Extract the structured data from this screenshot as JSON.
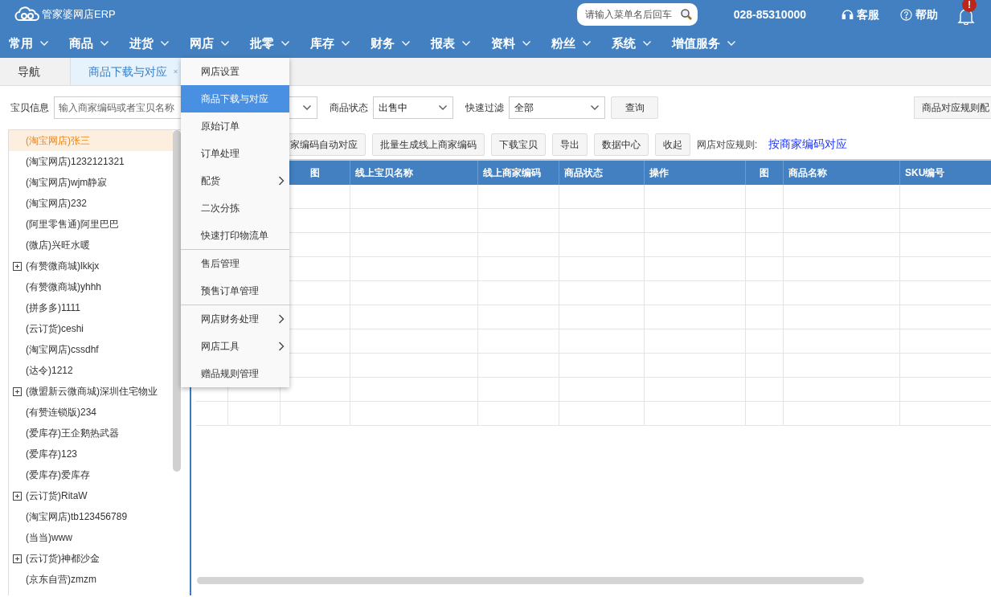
{
  "header": {
    "logo_text": "管家婆网店ERP",
    "search": {
      "placeholder": "请输入菜单名后回车"
    },
    "phone": "028-85310000",
    "links": [
      {
        "kind": "support",
        "label": "客服"
      },
      {
        "kind": "help",
        "label": "帮助"
      }
    ],
    "notification_badge": "!"
  },
  "nav": [
    "常用",
    "商品",
    "进货",
    "网店",
    "批零",
    "库存",
    "财务",
    "报表",
    "资料",
    "粉丝",
    "系统",
    "增值服务"
  ],
  "tabs": [
    {
      "label": "导航",
      "selected": false,
      "closable": false
    },
    {
      "label": "商品下载与对应",
      "selected": true,
      "closable": true
    }
  ],
  "menu": {
    "groups": [
      [
        {
          "label": "网店设置",
          "selected": false,
          "submenu": false
        },
        {
          "label": "商品下载与对应",
          "selected": true,
          "submenu": false
        },
        {
          "label": "原始订单",
          "selected": false,
          "submenu": false
        },
        {
          "label": "订单处理",
          "selected": false,
          "submenu": false
        },
        {
          "label": "配货",
          "selected": false,
          "submenu": true
        },
        {
          "label": "二次分拣",
          "selected": false,
          "submenu": false
        },
        {
          "label": "快速打印物流单",
          "selected": false,
          "submenu": false
        }
      ],
      [
        {
          "label": "售后管理",
          "selected": false,
          "submenu": false
        },
        {
          "label": "预售订单管理",
          "selected": false,
          "submenu": false
        }
      ],
      [
        {
          "label": "网店财务处理",
          "selected": false,
          "submenu": true
        },
        {
          "label": "网店工具",
          "selected": false,
          "submenu": true
        },
        {
          "label": "赠品规则管理",
          "selected": false,
          "submenu": false
        }
      ]
    ]
  },
  "filters": {
    "item_label": "宝贝信息",
    "item_placeholder": "输入商家编码或者宝贝名称",
    "status_label": "商品状态",
    "status_value": "出售中",
    "quick_label": "快速过滤",
    "quick_value": "全部",
    "query_button": "查询",
    "rules_button": "商品对应规则配"
  },
  "toolbar": {
    "buttons": [
      "家编码自动对应",
      "批量生成线上商家编码",
      "下载宝贝",
      "导出",
      "数据中心",
      "收起"
    ],
    "rule_label": "网店对应规则:",
    "rule_link": "按商家编码对应"
  },
  "tree": [
    {
      "label": "(淘宝网店)张三",
      "selected": true,
      "expandable": false
    },
    {
      "label": "(淘宝网店)1232121321",
      "selected": false,
      "expandable": false
    },
    {
      "label": "(淘宝网店)wjm静寂",
      "selected": false,
      "expandable": false
    },
    {
      "label": "(淘宝网店)232",
      "selected": false,
      "expandable": false
    },
    {
      "label": "(阿里零售通)阿里巴巴",
      "selected": false,
      "expandable": false
    },
    {
      "label": "(微店)兴旺水暖",
      "selected": false,
      "expandable": false
    },
    {
      "label": "(有赞微商城)lkkjx",
      "selected": false,
      "expandable": true
    },
    {
      "label": "(有赞微商城)yhhh",
      "selected": false,
      "expandable": false
    },
    {
      "label": "(拼多多)1111",
      "selected": false,
      "expandable": false
    },
    {
      "label": "(云订货)ceshi",
      "selected": false,
      "expandable": false
    },
    {
      "label": "(淘宝网店)cssdhf",
      "selected": false,
      "expandable": false
    },
    {
      "label": "(达令)1212",
      "selected": false,
      "expandable": false
    },
    {
      "label": "(微盟新云微商城)深圳住宅物业",
      "selected": false,
      "expandable": true
    },
    {
      "label": "(有赞连锁版)234",
      "selected": false,
      "expandable": false
    },
    {
      "label": "(爱库存)王企鹅热武器",
      "selected": false,
      "expandable": false
    },
    {
      "label": "(爱库存)123",
      "selected": false,
      "expandable": false
    },
    {
      "label": "(爱库存)爱库存",
      "selected": false,
      "expandable": false
    },
    {
      "label": "(云订货)RitaW",
      "selected": false,
      "expandable": true
    },
    {
      "label": "(淘宝网店)tb123456789",
      "selected": false,
      "expandable": false
    },
    {
      "label": "(当当)www",
      "selected": false,
      "expandable": false
    },
    {
      "label": "(云订货)神都沙金",
      "selected": false,
      "expandable": true
    },
    {
      "label": "(京东自营)zmzm",
      "selected": false,
      "expandable": false
    }
  ],
  "table": {
    "columns": [
      "图",
      "线上宝贝名称",
      "线上商家编码",
      "商品状态",
      "操作",
      "图",
      "商品名称",
      "SKU编号"
    ]
  }
}
